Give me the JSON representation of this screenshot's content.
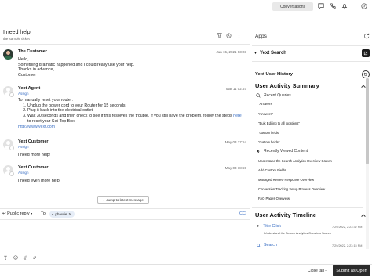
{
  "topbar": {
    "conversations_label": "Conversations",
    "icons": [
      "chat-icon",
      "phone-icon",
      "bell-icon",
      "help-icon"
    ]
  },
  "ticket": {
    "title": "I need help",
    "subtitle": "the sample ticket"
  },
  "messages": [
    {
      "author": "The Customer",
      "time": "Jun 15, 2021 03:23",
      "lines": [
        "Hello,",
        "Something dramatic happened and I could really use your help.",
        "Thanks in advance,",
        "Customer"
      ]
    },
    {
      "author": "Yext Agent",
      "assign": "Assign",
      "time": "Mar 11 02:57",
      "intro": "To manually reset your router:",
      "steps": [
        "Unplug the power cord to your Router for 15 seconds",
        "Plug it back into the electrical outlet.",
        "Wait 30 seconds and then check to see if this resolves the trouble. If you still have the problem, follow the steps"
      ],
      "step3_link": "here",
      "step3_tail": "to reset your Set-Top Box.",
      "link": "http://www.yext.com"
    },
    {
      "author": "Yext Customer",
      "assign": "Assign",
      "time": "May 03 17:54",
      "text": "I need more help!"
    },
    {
      "author": "Yext Customer",
      "assign": "Assign",
      "time": "May 03 18:59",
      "text": "I need even more help!"
    }
  ],
  "jump_label": "Jump to latest message",
  "reply": {
    "mode_label": "Public reply",
    "to_label": "To",
    "recipient": "pbaurie",
    "cc_label": "CC"
  },
  "bottom": {
    "close_tab_label": "Close tab",
    "submit_label": "Submit as Open"
  },
  "apps": {
    "title": "Apps",
    "app_name": "Yext Search",
    "user_history_label": "Yext User History",
    "activity_summary_title": "User Activity Summary",
    "recent_queries_label": "Recent Queries",
    "recent_queries": [
      "\"Answers\"",
      "\"Answers\"",
      "\"Bulk Editing to all locations\"",
      "\"custom fields\"",
      "\"custom fields\""
    ],
    "recently_viewed_label": "Recently Viewed Content",
    "recently_viewed": [
      "Understand the Search Analytics Overview Screen",
      "Add Custom Fields",
      "Managed Review Response Overview",
      "Conversion Tracking Setup Process Overview",
      "FAQ Pages Overview"
    ],
    "timeline_title": "User Activity Timeline",
    "timeline": [
      {
        "label": "Title Click",
        "time": "7/29/2022, 2:23:32 PM",
        "subtext": "Understand the Search Analytics Overview Screen"
      },
      {
        "label": "Search",
        "time": "7/29/2022, 2:23:15 PM"
      }
    ]
  }
}
